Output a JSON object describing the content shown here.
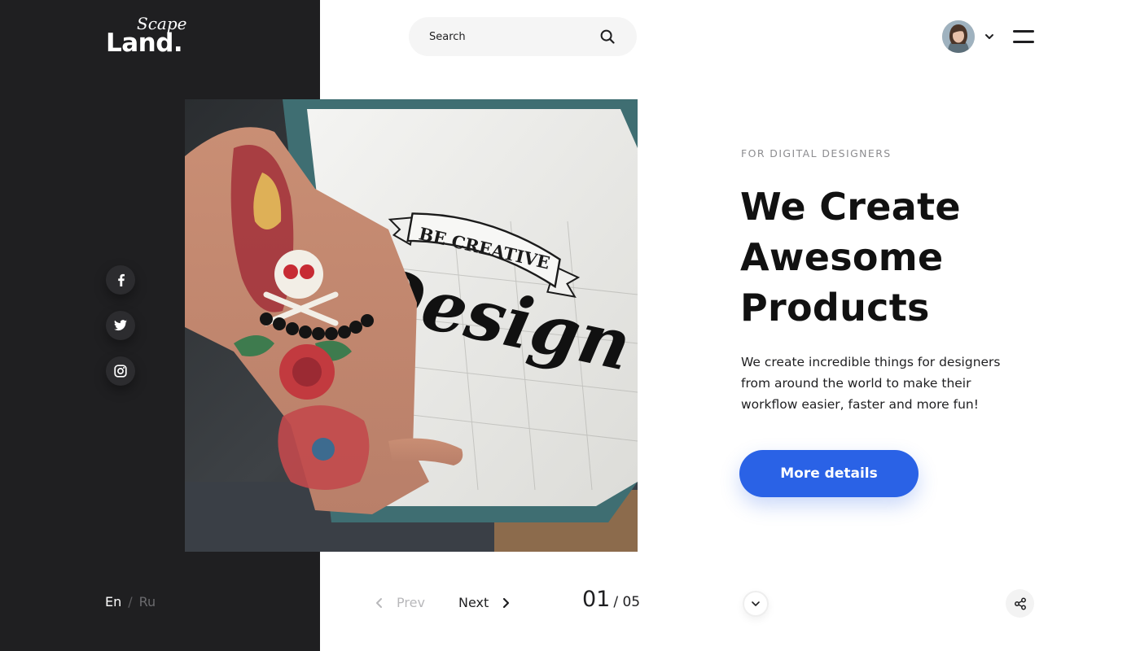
{
  "brand": {
    "script": "Scape",
    "name": "Land."
  },
  "search": {
    "placeholder": "Search",
    "icon": "search-icon"
  },
  "header": {
    "avatar_icon": "user-avatar",
    "dropdown_icon": "chevron-down-icon",
    "menu_icon": "hamburger-menu-icon"
  },
  "social": [
    {
      "name": "facebook",
      "icon": "facebook-icon"
    },
    {
      "name": "twitter",
      "icon": "twitter-icon"
    },
    {
      "name": "instagram",
      "icon": "instagram-icon"
    }
  ],
  "hero": {
    "image": {
      "banner_text": "BE CREATIVE",
      "script_text": "Design"
    },
    "eyebrow": "For Digital Designers",
    "headline": [
      "We Create",
      "Awesome",
      "Products"
    ],
    "description": "We create incredible things for designers from around the world to make their workflow easier, faster and more fun!",
    "cta_label": "More details"
  },
  "language": {
    "active": "En",
    "separator": "/",
    "inactive": "Ru"
  },
  "slider": {
    "prev_label": "Prev",
    "next_label": "Next",
    "current": "01",
    "total": "/ 05"
  },
  "colors": {
    "sidebar": "#1f1f21",
    "accent": "#2a62e6",
    "text": "#111111",
    "muted": "#8d8d90"
  }
}
